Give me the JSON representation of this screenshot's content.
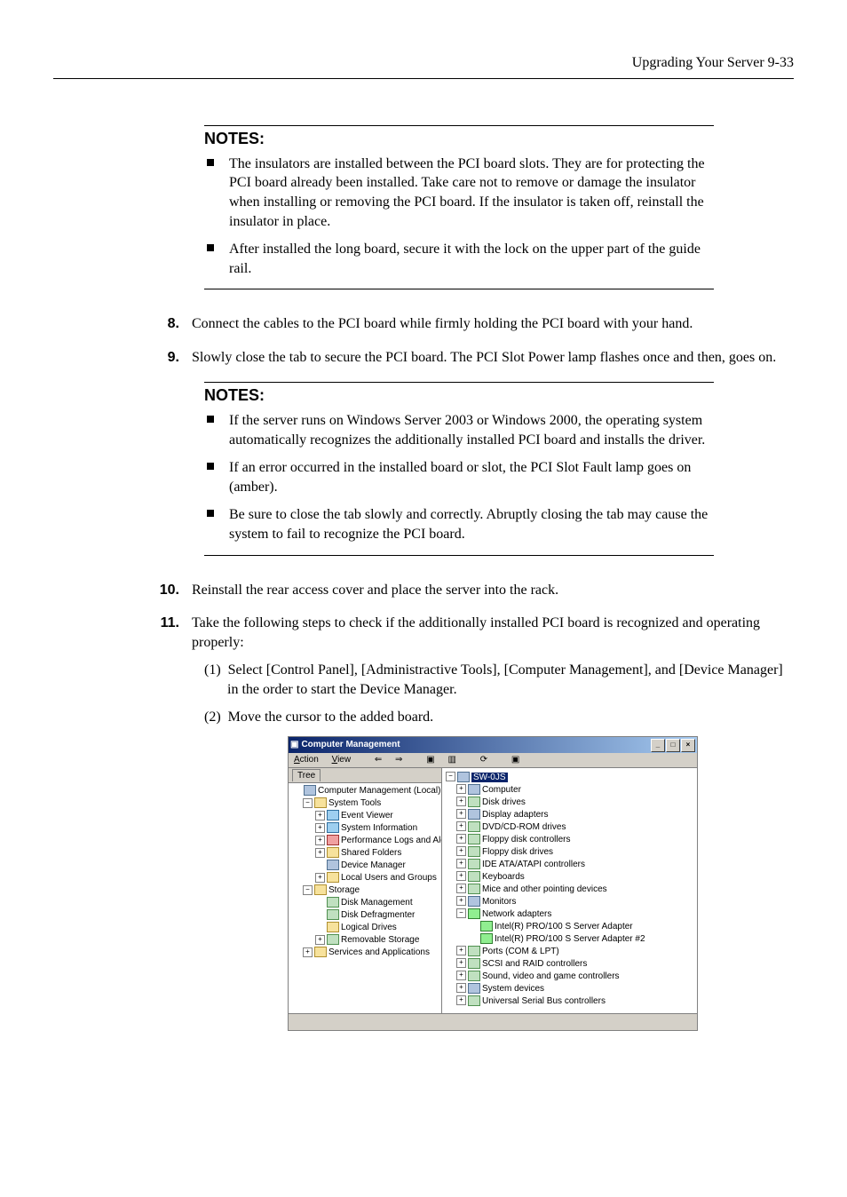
{
  "header": {
    "text": "Upgrading Your Server   9-33"
  },
  "notes1": {
    "title": "NOTES:",
    "items": [
      "The insulators are installed between the PCI board slots. They are for protecting the PCI board already been installed. Take care not to remove or damage the insulator when installing or removing the PCI board. If the insulator is taken off, reinstall the insulator in place.",
      "After installed the long board, secure it with the lock on the upper part of the guide rail."
    ]
  },
  "step8": {
    "num": "8.",
    "text": "Connect the cables to the PCI board while firmly holding the PCI board with your hand."
  },
  "step9": {
    "num": "9.",
    "text": "Slowly close the tab to secure the PCI board. The PCI Slot Power lamp flashes once and then, goes on."
  },
  "notes2": {
    "title": "NOTES:",
    "items": [
      "If the server runs on Windows Server 2003 or Windows 2000, the operating system automatically recognizes the additionally installed PCI board and installs the driver.",
      "If an error occurred in the installed board or slot, the PCI Slot Fault lamp goes on (amber).",
      "Be sure to close the tab slowly and correctly.  Abruptly closing the tab may cause the system to fail to recognize the PCI board."
    ]
  },
  "step10": {
    "num": "10.",
    "text": "Reinstall the rear access cover and place the server into the rack."
  },
  "step11": {
    "num": "11.",
    "text": "Take the following steps to check if the additionally installed PCI board is recognized and operating properly:",
    "sub1": {
      "num": "(1)",
      "text": "Select [Control Panel], [Administractive Tools], [Computer Management], and [Device Manager] in the order to start the Device Manager."
    },
    "sub2": {
      "num": "(2)",
      "text": "Move the cursor to the added board."
    }
  },
  "screenshot": {
    "title": "Computer Management",
    "menu": {
      "action": "Action",
      "view": "View"
    },
    "tabs": {
      "tree": "Tree"
    },
    "left_tree": [
      {
        "lvl": 1,
        "exp": "",
        "ico": "comp",
        "label": "Computer Management (Local)"
      },
      {
        "lvl": 2,
        "exp": "−",
        "ico": "folder",
        "label": "System Tools"
      },
      {
        "lvl": 3,
        "exp": "+",
        "ico": "blue",
        "label": "Event Viewer"
      },
      {
        "lvl": 3,
        "exp": "+",
        "ico": "blue",
        "label": "System Information"
      },
      {
        "lvl": 3,
        "exp": "+",
        "ico": "red",
        "label": "Performance Logs and Alerts"
      },
      {
        "lvl": 3,
        "exp": "+",
        "ico": "folder",
        "label": "Shared Folders"
      },
      {
        "lvl": 3,
        "exp": "",
        "ico": "comp",
        "label": "Device Manager"
      },
      {
        "lvl": 3,
        "exp": "+",
        "ico": "folder",
        "label": "Local Users and Groups"
      },
      {
        "lvl": 2,
        "exp": "−",
        "ico": "folder",
        "label": "Storage"
      },
      {
        "lvl": 3,
        "exp": "",
        "ico": "dev",
        "label": "Disk Management"
      },
      {
        "lvl": 3,
        "exp": "",
        "ico": "dev",
        "label": "Disk Defragmenter"
      },
      {
        "lvl": 3,
        "exp": "",
        "ico": "folder",
        "label": "Logical Drives"
      },
      {
        "lvl": 3,
        "exp": "+",
        "ico": "dev",
        "label": "Removable Storage"
      },
      {
        "lvl": 2,
        "exp": "+",
        "ico": "folder",
        "label": "Services and Applications"
      }
    ],
    "right_tree": [
      {
        "lvl": 1,
        "exp": "−",
        "ico": "comp",
        "label": "SW-0JS",
        "selected": true
      },
      {
        "lvl": 2,
        "exp": "+",
        "ico": "comp",
        "label": "Computer"
      },
      {
        "lvl": 2,
        "exp": "+",
        "ico": "dev",
        "label": "Disk drives"
      },
      {
        "lvl": 2,
        "exp": "+",
        "ico": "comp",
        "label": "Display adapters"
      },
      {
        "lvl": 2,
        "exp": "+",
        "ico": "dev",
        "label": "DVD/CD-ROM drives"
      },
      {
        "lvl": 2,
        "exp": "+",
        "ico": "dev",
        "label": "Floppy disk controllers"
      },
      {
        "lvl": 2,
        "exp": "+",
        "ico": "dev",
        "label": "Floppy disk drives"
      },
      {
        "lvl": 2,
        "exp": "+",
        "ico": "dev",
        "label": "IDE ATA/ATAPI controllers"
      },
      {
        "lvl": 2,
        "exp": "+",
        "ico": "dev",
        "label": "Keyboards"
      },
      {
        "lvl": 2,
        "exp": "+",
        "ico": "dev",
        "label": "Mice and other pointing devices"
      },
      {
        "lvl": 2,
        "exp": "+",
        "ico": "comp",
        "label": "Monitors"
      },
      {
        "lvl": 2,
        "exp": "−",
        "ico": "net",
        "label": "Network adapters"
      },
      {
        "lvl": 3,
        "exp": "",
        "ico": "net",
        "label": "Intel(R) PRO/100 S Server Adapter"
      },
      {
        "lvl": 3,
        "exp": "",
        "ico": "net",
        "label": "Intel(R) PRO/100 S Server Adapter #2"
      },
      {
        "lvl": 2,
        "exp": "+",
        "ico": "dev",
        "label": "Ports (COM & LPT)"
      },
      {
        "lvl": 2,
        "exp": "+",
        "ico": "dev",
        "label": "SCSI and RAID controllers"
      },
      {
        "lvl": 2,
        "exp": "+",
        "ico": "dev",
        "label": "Sound, video and game controllers"
      },
      {
        "lvl": 2,
        "exp": "+",
        "ico": "comp",
        "label": "System devices"
      },
      {
        "lvl": 2,
        "exp": "+",
        "ico": "dev",
        "label": "Universal Serial Bus controllers"
      }
    ]
  }
}
